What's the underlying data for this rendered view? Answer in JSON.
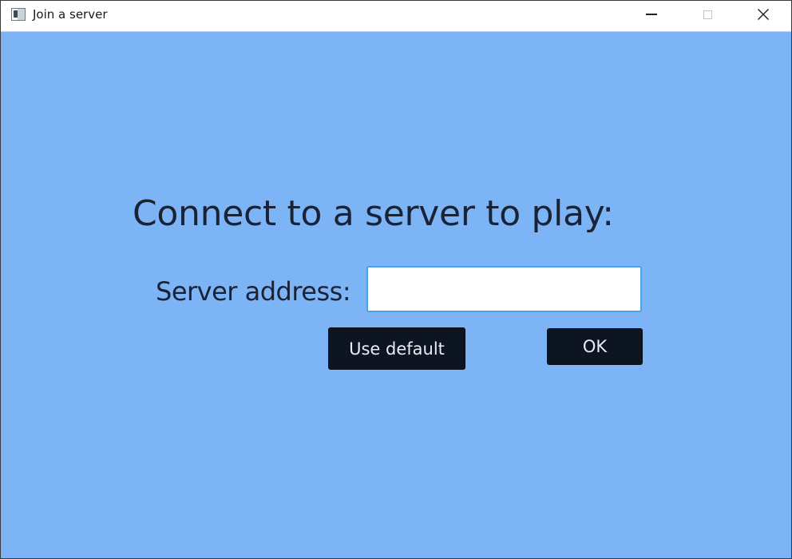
{
  "window": {
    "title": "Join a server",
    "background_color": "#7cb4f5",
    "app_icon": "app-window-icon",
    "controls": {
      "minimize_icon": "minimize-icon",
      "maximize_icon": "maximize-icon",
      "close_icon": "close-icon",
      "close_glyph": "✕"
    }
  },
  "main": {
    "heading": "Connect to a server to play:",
    "address_label": "Server address:",
    "address_value": "",
    "use_default_label": "Use default",
    "ok_label": "OK",
    "button_color": "#0d1522",
    "input_border_color": "#4aa3e8"
  }
}
